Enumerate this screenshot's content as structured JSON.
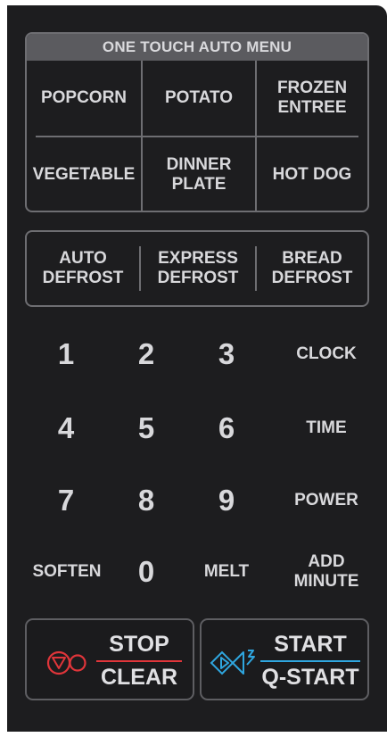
{
  "colors": {
    "panel": "#1d1d1f",
    "text": "#d8d8db",
    "border": "#6e6e72",
    "header_bg": "#5b5b5f",
    "stop_accent": "#e0353a",
    "start_accent": "#2fa6df"
  },
  "onetouch": {
    "header": "ONE TOUCH AUTO MENU",
    "items": [
      {
        "label": "POPCORN"
      },
      {
        "label": "POTATO"
      },
      {
        "label": "FROZEN\nENTREE"
      },
      {
        "label": "VEGETABLE"
      },
      {
        "label": "DINNER\nPLATE"
      },
      {
        "label": "HOT DOG"
      }
    ]
  },
  "defrost": {
    "items": [
      {
        "label": "AUTO\nDEFROST"
      },
      {
        "label": "EXPRESS\nDEFROST"
      },
      {
        "label": "BREAD\nDEFROST"
      }
    ]
  },
  "keypad": {
    "digits": [
      "1",
      "2",
      "3",
      "4",
      "5",
      "6",
      "7",
      "8",
      "9",
      "0"
    ],
    "clock": "CLOCK",
    "time": "TIME",
    "power": "POWER",
    "soften": "SOFTEN",
    "melt": "MELT",
    "add_minute": "ADD\nMINUTE"
  },
  "stop_clear": {
    "line1": "STOP",
    "line2": "CLEAR",
    "icon": "stop-icon"
  },
  "start": {
    "line1": "START",
    "line2": "Q-START",
    "icon": "start-icon"
  }
}
